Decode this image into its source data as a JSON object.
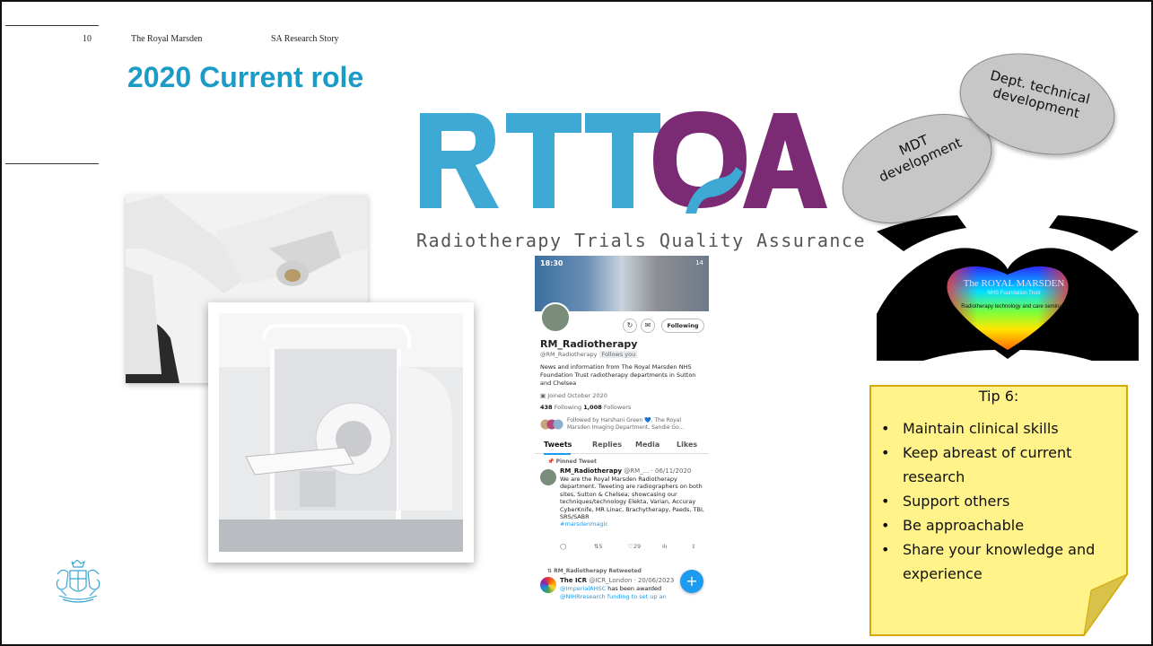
{
  "header": {
    "slide_number": "10",
    "organisation": "The Royal Marsden",
    "story": "SA Research Story"
  },
  "title": "2020 Current role",
  "logo": {
    "text": "RTTQA",
    "subtitle": "Radiotherapy Trials Quality Assurance",
    "colors": {
      "blue": "#3fa9d6",
      "purple": "#7b2a74"
    }
  },
  "bubbles": {
    "mdt": "MDT development",
    "dept": "Dept. technical development"
  },
  "heart": {
    "org": "The ROYAL MARSDEN",
    "trust": "NHS Foundation Trust",
    "seminar": "Radiotherapy technology and care seminars"
  },
  "tip": {
    "title": "Tip 6:",
    "items": [
      "Maintain clinical skills",
      "Keep abreast of current research",
      "Support others",
      "Be approachable",
      "Share your knowledge and experience"
    ],
    "color": "#fff38a"
  },
  "twitter": {
    "time": "18:30",
    "signal": "14",
    "following_button": "Following",
    "name": "RM_Radiotherapy",
    "handle": "@RM_Radiotherapy",
    "follows_you": "Follows you",
    "bio": "News and information from The Royal Marsden NHS Foundation Trust radiotherapy departments in Sutton and Chelsea",
    "joined": "Joined October 2020",
    "following_count": "438",
    "following_label": "Following",
    "followers_count": "1,008",
    "followers_label": "Followers",
    "followed_by": "Followed by Harshani Green 💙, The Royal Marsden Imaging Department, Sandie Go...",
    "tabs": [
      "Tweets",
      "Replies",
      "Media",
      "Likes"
    ],
    "pinned_label": "Pinned Tweet",
    "tweet1": {
      "author": "RM_Radiotherapy",
      "meta": "@RM_... · 06/11/2020",
      "text": "We are the Royal Marsden Radiotherapy department. Tweeting are radiographers on both sites, Sutton & Chelsea; showcasing our techniques/technology Elekta, Varian, Accuray CyberKnife, MR Linac, Brachytherapy, Paeds, TBI, SRS/SABR",
      "hashtag": "#marsdenmagic",
      "retweets": "5",
      "likes": "29"
    },
    "retweeted_label": "RM_Radiotherapy Retweeted",
    "tweet2": {
      "author": "The ICR",
      "meta": "@ICR_London · 20/06/2023",
      "mention": "@ImperialAHSC",
      "text": "has been awarded",
      "tail": "@NIHRresearch funding to set up an"
    }
  }
}
